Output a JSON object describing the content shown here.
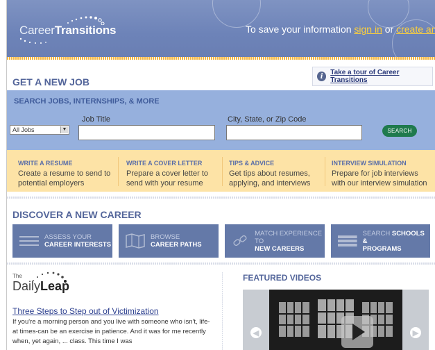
{
  "header": {
    "logo_career": "Career",
    "logo_transitions": "Transitions",
    "save_prefix": "To save your information ",
    "sign_in": "sign in",
    "or": " or ",
    "create_account": "create an accou"
  },
  "job": {
    "title": "GET A NEW JOB",
    "tour_label": "Take a tour of Career Transitions",
    "search_title": "SEARCH JOBS, INTERNSHIPS, & MORE",
    "job_title_label": "Job Title",
    "location_label": "City, State, or Zip Code",
    "job_type_selected": "All Jobs",
    "job_title_value": "",
    "location_value": "",
    "search_button": "SEARCH"
  },
  "tools": [
    {
      "title": "WRITE A RESUME",
      "desc": "Create a resume to send to potential employers"
    },
    {
      "title": "WRITE A COVER LETTER",
      "desc": "Prepare a cover letter to send with your resume"
    },
    {
      "title": "TIPS & ADVICE",
      "desc": "Get tips about resumes, applying, and interviews"
    },
    {
      "title": "INTERVIEW SIMULATION",
      "desc": "Prepare for job interviews with our interview simulation"
    }
  ],
  "career": {
    "title": "DISCOVER A NEW CAREER",
    "buttons": [
      {
        "top": "ASSESS YOUR",
        "bottom": "CAREER INTERESTS",
        "icon": "list-icon"
      },
      {
        "top": "BROWSE",
        "bottom": "CAREER PATHS",
        "icon": "map-icon"
      },
      {
        "top": "MATCH EXPERIENCE TO",
        "bottom": "NEW CAREERS",
        "icon": "link-icon"
      },
      {
        "top": "SEARCH",
        "top_bold": "SCHOOLS &",
        "bottom": "PROGRAMS",
        "icon": "books-icon"
      }
    ]
  },
  "daily_leap": {
    "logo_the": "The",
    "logo_daily": "Daily",
    "logo_leap": "Leap",
    "article_title": "Three Steps to Step out of Victimization",
    "article_line1": "If you're a morning person and you live with someone who isn't, life-",
    "article_line2": "at times-can be an exercise in patience. And it was for me recently",
    "article_line3": "when, yet again, ... class. This time I was"
  },
  "videos": {
    "title": "FEATURED VIDEOS"
  },
  "colors": {
    "header": "#6d83b8",
    "accent_yellow": "#ffd13a",
    "search_panel": "#96b0dd",
    "tools_panel": "#fde3a6",
    "career_button": "#6479a8",
    "search_button": "#1f7a4d"
  }
}
